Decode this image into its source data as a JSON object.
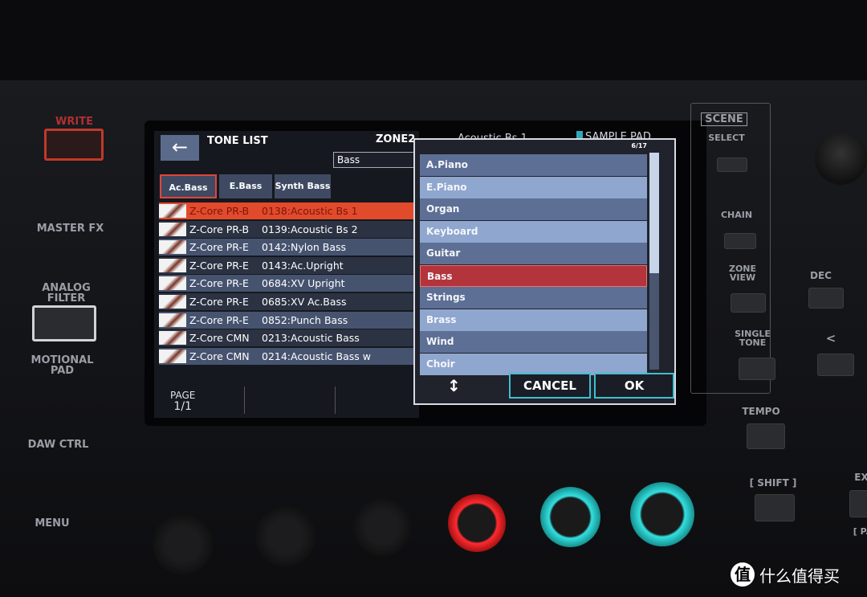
{
  "hardware": {
    "write": "WRITE",
    "master_fx": "MASTER FX",
    "analog_filter": "ANALOG FILTER",
    "motional_pad": "MOTIONAL PAD",
    "daw_ctrl": "DAW CTRL",
    "menu": "MENU",
    "scene": "SCENE",
    "select": "SELECT",
    "chain": "CHAIN",
    "zone_view": "ZONE VIEW",
    "single_tone": "SINGLE TONE",
    "dec": "DEC",
    "prev": "<",
    "tempo": "TEMPO",
    "shift": "[ SHIFT ]",
    "ex": "EX",
    "pa": "[ PA"
  },
  "screen": {
    "back_icon": "arrow-left-icon",
    "title": "TONE LIST",
    "zone": "ZONE2",
    "current_tone": "Acoustic Bs 1",
    "sample_pad": "SAMPLE PAD",
    "search_value": "Bass",
    "tabs": [
      {
        "label": "Ac.Bass",
        "selected": true
      },
      {
        "label": "E.Bass"
      },
      {
        "label": "Synth Bass"
      }
    ],
    "rows": [
      {
        "bank": "Z-Core PR-B",
        "name": "0138:Acoustic Bs 1",
        "selected": true
      },
      {
        "bank": "Z-Core PR-B",
        "name": "0139:Acoustic Bs 2"
      },
      {
        "bank": "Z-Core PR-E",
        "name": "0142:Nylon Bass"
      },
      {
        "bank": "Z-Core PR-E",
        "name": "0143:Ac.Upright"
      },
      {
        "bank": "Z-Core PR-E",
        "name": "0684:XV Upright"
      },
      {
        "bank": "Z-Core PR-E",
        "name": "0685:XV Ac.Bass"
      },
      {
        "bank": "Z-Core PR-E",
        "name": "0852:Punch Bass"
      },
      {
        "bank": "Z-Core CMN",
        "name": "0213:Acoustic Bass"
      },
      {
        "bank": "Z-Core CMN",
        "name": "0214:Acoustic Bass w"
      }
    ],
    "page_label": "PAGE",
    "page_value": "1/1"
  },
  "popup": {
    "counter": "6/17",
    "items": [
      "A.Piano",
      "E.Piano",
      "Organ",
      "Keyboard",
      "Guitar",
      "Bass",
      "Strings",
      "Brass",
      "Wind",
      "Choir"
    ],
    "selected_index": 5,
    "cancel": "CANCEL",
    "ok": "OK",
    "updown_icon": "up-down-arrow-icon"
  },
  "colors": {
    "selected_row": "#e24a2c",
    "popup_selected": "#b4343c",
    "button_border": "#3fbfd0",
    "knob_red": "#ff2a30",
    "knob_cyan": "#33e0e0"
  },
  "watermark": "什么值得买"
}
